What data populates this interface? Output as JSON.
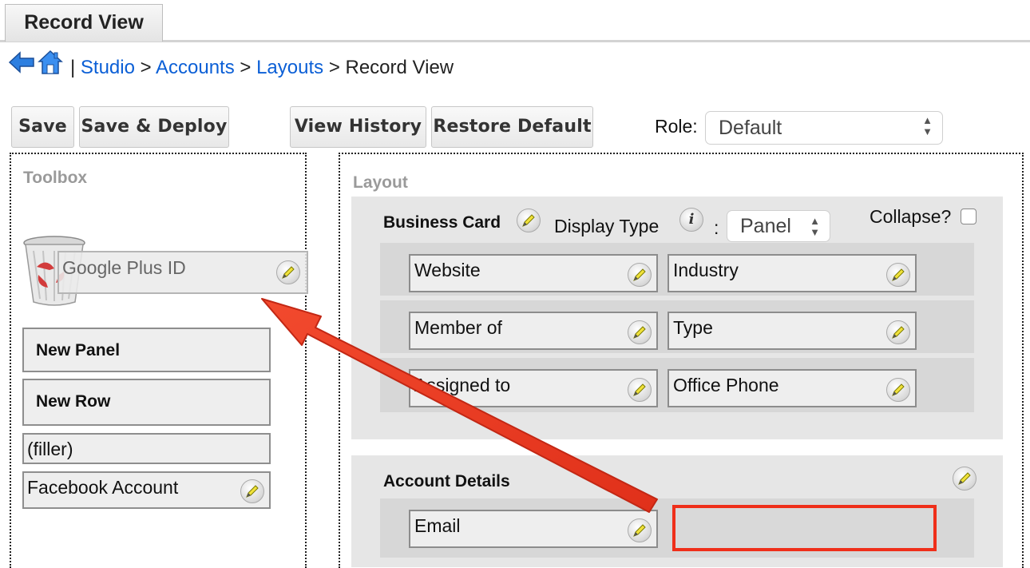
{
  "tab": {
    "label": "Record View"
  },
  "breadcrumb": {
    "separator": "|",
    "items": [
      "Studio",
      "Accounts",
      "Layouts"
    ],
    "current": "Record View",
    "arrow": ">"
  },
  "toolbar": {
    "save": "Save",
    "save_deploy": "Save & Deploy",
    "view_history": "View History",
    "restore_default": "Restore Default",
    "role_label": "Role:",
    "role_value": "Default"
  },
  "toolbox": {
    "title": "Toolbox",
    "dragged_field": "Google Plus ID",
    "items": [
      "New Panel",
      "New Row",
      "(filler)",
      "Facebook Account"
    ]
  },
  "layout": {
    "title": "Layout",
    "business_card": {
      "name": "Business Card",
      "display_type_label": "Display Type",
      "colon": ":",
      "display_type_value": "Panel",
      "collapse_label": "Collapse?",
      "rows": [
        [
          "Website",
          "Industry"
        ],
        [
          "Member of",
          "Type"
        ],
        [
          "Assigned to",
          "Office Phone"
        ]
      ]
    },
    "account_details": {
      "name": "Account Details",
      "rows": [
        [
          "Email",
          ""
        ]
      ]
    }
  },
  "colors": {
    "link": "#0b5fd6",
    "annotation_arrow": "#ef2f1a",
    "highlight_box": "#ef2f1a"
  }
}
